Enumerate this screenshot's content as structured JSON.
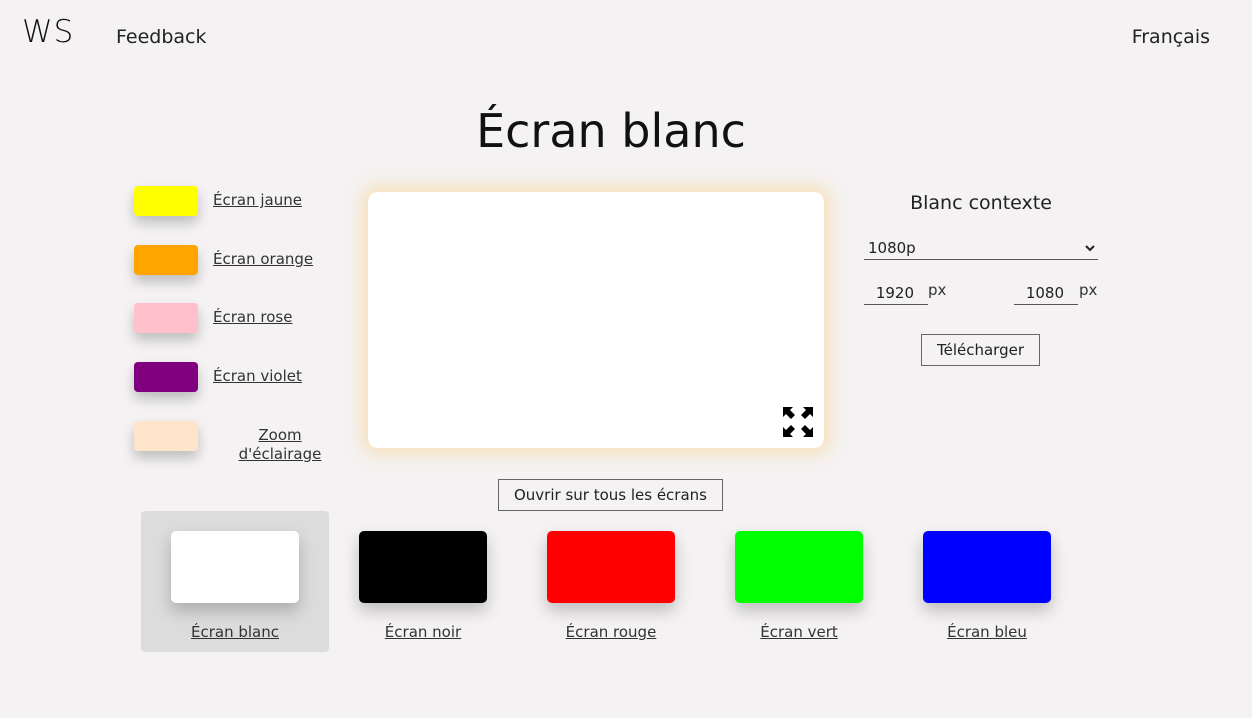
{
  "header": {
    "logo": "WS",
    "feedback": "Feedback",
    "language": "Français"
  },
  "page": {
    "title": "Écran blanc"
  },
  "left_swatches": [
    {
      "label": "Écran jaune",
      "color": "#ffff00"
    },
    {
      "label": "Écran orange",
      "color": "#ffa500"
    },
    {
      "label": "Écran rose",
      "color": "#ffc0cb"
    },
    {
      "label": "Écran violet",
      "color": "#800080"
    },
    {
      "label": "Zoom d'éclairage",
      "color": "#ffe4cc"
    }
  ],
  "preview": {
    "color": "#ffffff",
    "fullscreen_icon": "expand-icon"
  },
  "panel": {
    "title": "Blanc contexte",
    "resolution": "1080p",
    "width": "1920",
    "height": "1080",
    "unit": "px",
    "download": "Télécharger"
  },
  "open_all_label": "Ouvrir sur tous les écrans",
  "bottom_swatches": [
    {
      "label": "Écran blanc",
      "color": "#ffffff",
      "selected": true
    },
    {
      "label": "Écran noir",
      "color": "#000000",
      "selected": false
    },
    {
      "label": "Écran rouge",
      "color": "#ff0000",
      "selected": false
    },
    {
      "label": "Écran vert",
      "color": "#00ff00",
      "selected": false
    },
    {
      "label": "Écran bleu",
      "color": "#0000ff",
      "selected": false
    }
  ]
}
